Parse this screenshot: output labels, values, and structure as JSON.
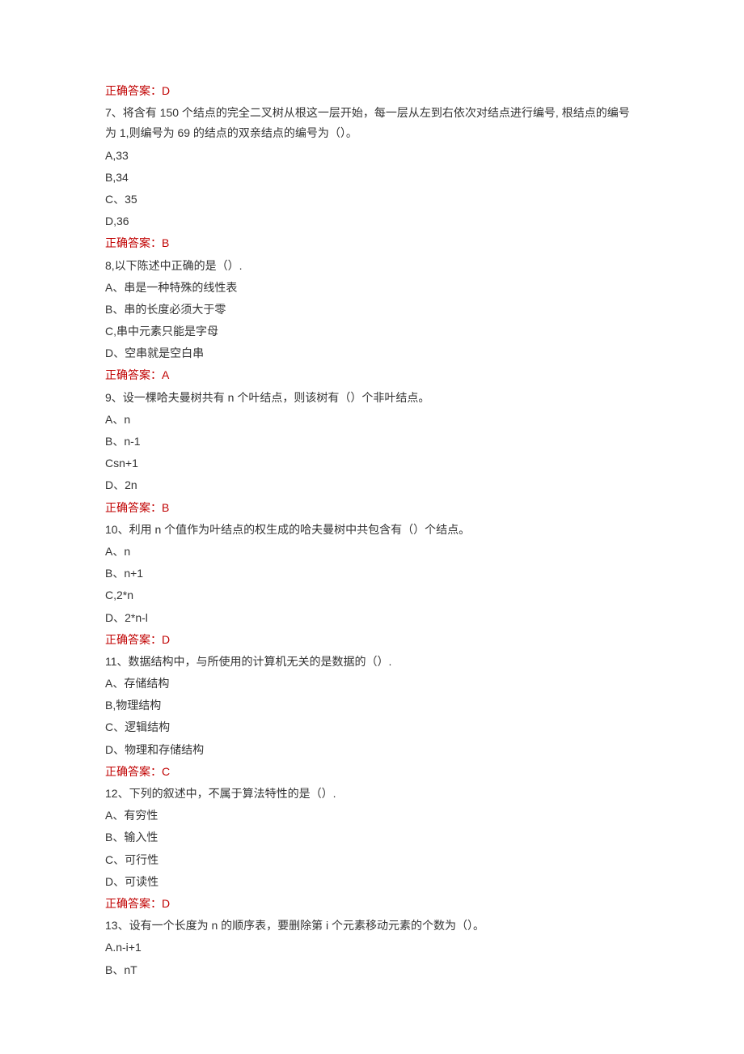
{
  "items": [
    {
      "type": "answer",
      "text": "正确答案：D"
    },
    {
      "type": "question",
      "text": "7、将含有 150 个结点的完全二叉树从根这一层开始，每一层从左到右依次对结点进行编号, 根结点的编号为 1,则编号为 69 的结点的双亲结点的编号为（）。"
    },
    {
      "type": "option",
      "text": "A,33"
    },
    {
      "type": "option",
      "text": "B,34"
    },
    {
      "type": "option",
      "text": "C、35"
    },
    {
      "type": "option",
      "text": "D,36"
    },
    {
      "type": "answer",
      "text": "正确答案：B"
    },
    {
      "type": "question",
      "text": "8,以下陈述中正确的是（）."
    },
    {
      "type": "option",
      "text": "A、串是一种特殊的线性表"
    },
    {
      "type": "option",
      "text": "B、串的长度必须大于零"
    },
    {
      "type": "option",
      "text": "C,串中元素只能是字母"
    },
    {
      "type": "option",
      "text": "D、空串就是空白串"
    },
    {
      "type": "answer",
      "text": "正确答案：A"
    },
    {
      "type": "question",
      "text": "9、设一棵哈夫曼树共有 n 个叶结点，则该树有（）个非叶结点。"
    },
    {
      "type": "option",
      "text": "A、n"
    },
    {
      "type": "option",
      "text": "B、n-1"
    },
    {
      "type": "option",
      "text": "Csn+1"
    },
    {
      "type": "option",
      "text": "D、2n"
    },
    {
      "type": "answer",
      "text": "正确答案：B"
    },
    {
      "type": "question",
      "text": "10、利用 n 个值作为叶结点的权生成的哈夫曼树中共包含有（）个结点。"
    },
    {
      "type": "option",
      "text": "A、n"
    },
    {
      "type": "option",
      "text": "B、n+1"
    },
    {
      "type": "option",
      "text": "C,2*n"
    },
    {
      "type": "option",
      "text": "D、2*n-l"
    },
    {
      "type": "answer",
      "text": "正确答案：D"
    },
    {
      "type": "question",
      "text": "11、数据结构中，与所使用的计算机无关的是数据的（）."
    },
    {
      "type": "option",
      "text": "A、存储结构"
    },
    {
      "type": "option",
      "text": "B,物理结构"
    },
    {
      "type": "option",
      "text": "C、逻辑结构"
    },
    {
      "type": "option",
      "text": "D、物理和存储结构"
    },
    {
      "type": "answer",
      "text": "正确答案：C"
    },
    {
      "type": "question",
      "text": "12、下列的叙述中，不属于算法特性的是（）."
    },
    {
      "type": "option",
      "text": "A、有穷性"
    },
    {
      "type": "option",
      "text": "B、输入性"
    },
    {
      "type": "option",
      "text": "C、可行性"
    },
    {
      "type": "option",
      "text": "D、可读性"
    },
    {
      "type": "answer",
      "text": "正确答案：D"
    },
    {
      "type": "question",
      "text": "13、设有一个长度为 n 的顺序表，要删除第 i 个元素移动元素的个数为（）。"
    },
    {
      "type": "option",
      "text": "A.n-i+1"
    },
    {
      "type": "option",
      "text": "B、nT"
    }
  ]
}
